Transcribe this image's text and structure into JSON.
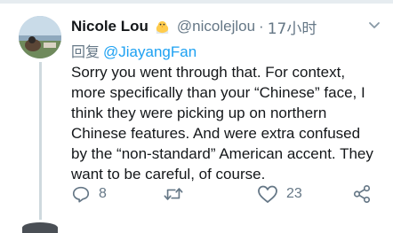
{
  "tweet": {
    "author_name": "Nicole Lou",
    "emoji_icon": "hatching-chick-icon",
    "handle": "@nicolejlou",
    "separator": "·",
    "time": "17小时",
    "reply_prefix": "回复",
    "reply_to": "@JiayangFan",
    "body_lines": [
      "Sorry you went through that. For context,",
      "more specifically than your “Chinese” face, I",
      "think they were picking up on northern",
      "Chinese features. And were extra confused",
      "by the “non-standard” American accent. They",
      "want to be careful, of course."
    ],
    "reply_count": "8",
    "like_count": "23"
  },
  "colors": {
    "text": "#14171a",
    "muted": "#657786",
    "link": "#1da1f2",
    "divider": "#e6ecf0"
  }
}
